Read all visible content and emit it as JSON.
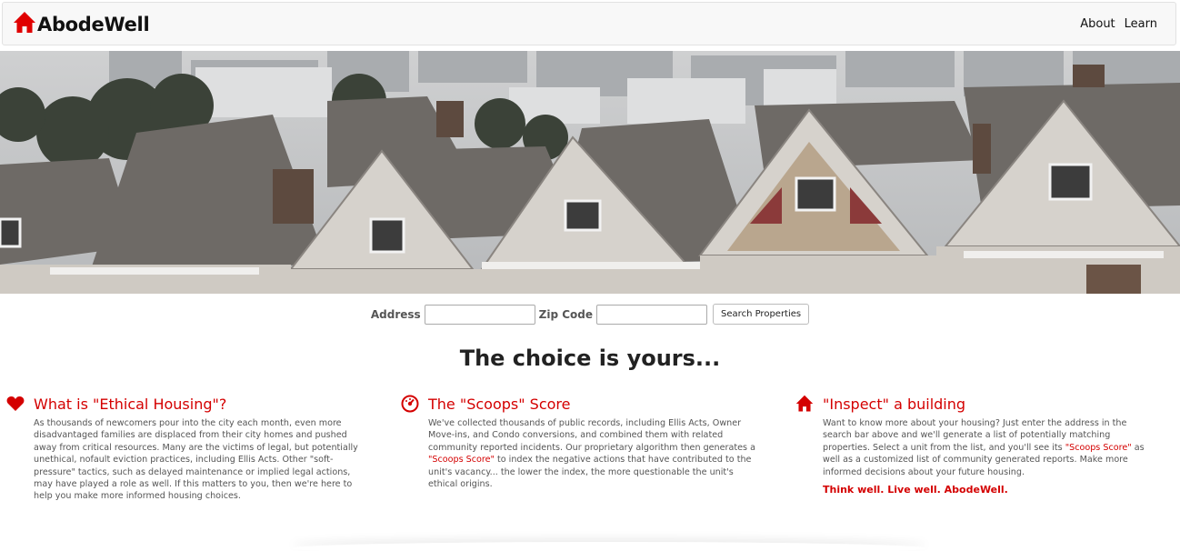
{
  "brand": {
    "name": "AbodeWell",
    "icon": "home-icon",
    "color": "#e00000"
  },
  "nav": {
    "items": [
      {
        "label": "About"
      },
      {
        "label": "Learn"
      }
    ]
  },
  "search": {
    "address_label": "Address",
    "address_value": "",
    "zip_label": "Zip Code",
    "zip_value": "",
    "button_label": "Search Properties"
  },
  "headline": "The choice is yours...",
  "features": [
    {
      "icon": "heart-icon",
      "title": "What is \"Ethical Housing\"?",
      "body": "As thousands of newcomers pour into the city each month, even more disadvantaged families are displaced from their city homes and pushed away from critical resources. Many are the victims of legal, but potentially unethical, nofault eviction practices, including Ellis Acts. Other \"soft-pressure\" tactics, such as delayed maintenance or implied legal actions, may have played a role as well. If this matters to you, then we're here to help you make more informed housing choices."
    },
    {
      "icon": "gauge-icon",
      "title": "The \"Scoops\" Score",
      "body_before": "We've collected thousands of public records, including Ellis Acts, Owner Move-ins, and Condo conversions, and combined them with related community reported incidents. Our proprietary algorithm then generates a ",
      "highlight": "\"Scoops Score\"",
      "body_after": " to index the negative actions that have contributed to the unit's vacancy... the lower the index, the more questionable the unit's ethical origins."
    },
    {
      "icon": "home-icon",
      "title": "\"Inspect\" a building",
      "body_before": "Want to know more about your housing? Just enter the address in the search bar above and we'll generate a list of potentially matching properties. Select a unit from the list, and you'll see its ",
      "highlight": "\"Scoops Score\"",
      "body_after": " as well as a customized list of community generated reports. Make more informed decisions about your future housing.",
      "tagline": "Think well. Live well. AbodeWell."
    }
  ],
  "colors": {
    "accent": "#d40000",
    "navbar_bg": "#f8f8f8"
  }
}
